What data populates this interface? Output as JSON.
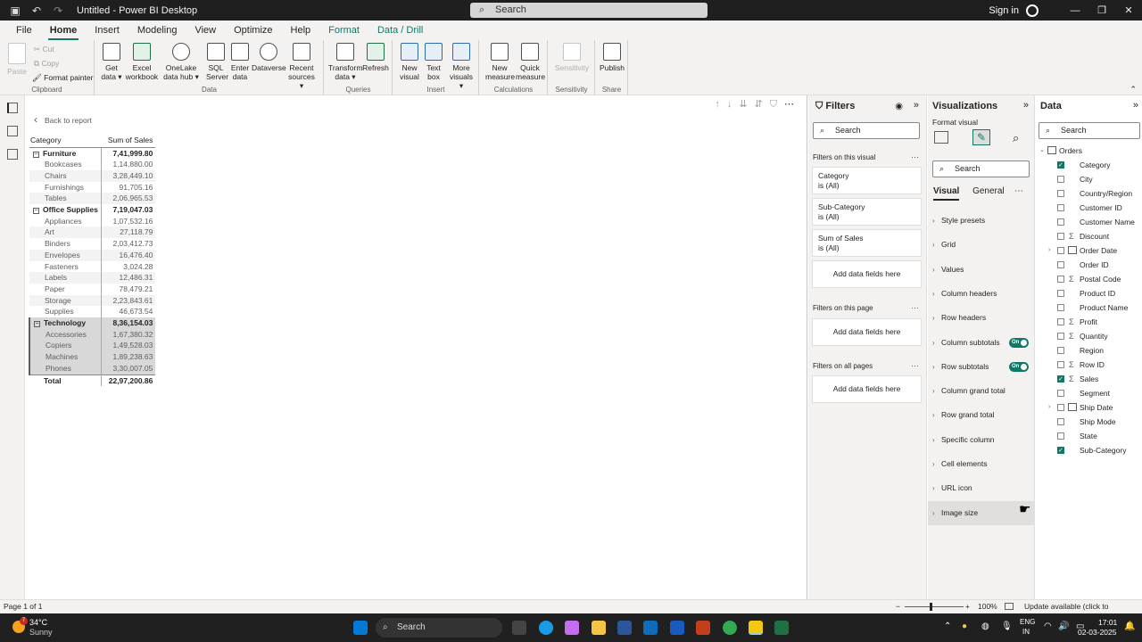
{
  "titlebar": {
    "title": "Untitled - Power BI Desktop",
    "search": "Search",
    "sign_in": "Sign in"
  },
  "menu": [
    "File",
    "Home",
    "Insert",
    "Modeling",
    "View",
    "Optimize",
    "Help",
    "Format",
    "Data / Drill"
  ],
  "ribbon": {
    "clipboard": {
      "paste": "Paste",
      "cut": "Cut",
      "copy": "Copy",
      "format_painter": "Format painter",
      "label": "Clipboard"
    },
    "data": {
      "get_data": "Get data ▾",
      "excel": "Excel workbook",
      "onelake": "OneLake data hub ▾",
      "sql": "SQL Server",
      "enter": "Enter data",
      "dataverse": "Dataverse",
      "recent": "Recent sources ▾",
      "label": "Data"
    },
    "queries": {
      "transform": "Transform data ▾",
      "refresh": "Refresh",
      "label": "Queries"
    },
    "insert": {
      "new_visual": "New visual",
      "text_box": "Text box",
      "more": "More visuals ▾",
      "label": "Insert"
    },
    "calculations": {
      "new_measure": "New measure",
      "quick_measure": "Quick measure",
      "label": "Calculations"
    },
    "sensitivity": {
      "btn": "Sensitivity",
      "label": "Sensitivity"
    },
    "share": {
      "publish": "Publish",
      "label": "Share"
    }
  },
  "canvas": {
    "back": "Back to report",
    "headers": [
      "Category",
      "Sum of Sales"
    ],
    "rows": [
      {
        "type": "cat",
        "label": "Furniture",
        "value": "7,41,999.80"
      },
      {
        "type": "sub",
        "label": "Bookcases",
        "value": "1,14,880.00"
      },
      {
        "type": "sub",
        "label": "Chairs",
        "value": "3,28,449.10"
      },
      {
        "type": "sub",
        "label": "Furnishings",
        "value": "91,705.16"
      },
      {
        "type": "sub",
        "label": "Tables",
        "value": "2,06,965.53"
      },
      {
        "type": "cat",
        "label": "Office Supplies",
        "value": "7,19,047.03"
      },
      {
        "type": "sub",
        "label": "Appliances",
        "value": "1,07,532.16"
      },
      {
        "type": "sub",
        "label": "Art",
        "value": "27,118.79"
      },
      {
        "type": "sub",
        "label": "Binders",
        "value": "2,03,412.73"
      },
      {
        "type": "sub",
        "label": "Envelopes",
        "value": "16,476.40"
      },
      {
        "type": "sub",
        "label": "Fasteners",
        "value": "3,024.28"
      },
      {
        "type": "sub",
        "label": "Labels",
        "value": "12,486.31"
      },
      {
        "type": "sub",
        "label": "Paper",
        "value": "78,479.21"
      },
      {
        "type": "sub",
        "label": "Storage",
        "value": "2,23,843.61"
      },
      {
        "type": "sub",
        "label": "Supplies",
        "value": "46,673.54"
      },
      {
        "type": "cat",
        "label": "Technology",
        "value": "8,36,154.03"
      },
      {
        "type": "sub",
        "label": "Accessories",
        "value": "1,67,380.32"
      },
      {
        "type": "sub",
        "label": "Copiers",
        "value": "1,49,528.03"
      },
      {
        "type": "sub",
        "label": "Machines",
        "value": "1,89,238.63"
      },
      {
        "type": "sub",
        "label": "Phones",
        "value": "3,30,007.05"
      },
      {
        "type": "total",
        "label": "Total",
        "value": "22,97,200.86"
      }
    ]
  },
  "filters": {
    "title": "Filters",
    "search": "Search",
    "on_visual": "Filters on this visual",
    "cards": [
      {
        "name": "Category",
        "state": "is (All)"
      },
      {
        "name": "Sub-Category",
        "state": "is (All)"
      },
      {
        "name": "Sum of Sales",
        "state": "is (All)"
      }
    ],
    "add": "Add data fields here",
    "on_page": "Filters on this page",
    "on_all": "Filters on all pages"
  },
  "viz": {
    "title": "Visualizations",
    "format_visual": "Format visual",
    "search": "Search",
    "tab_visual": "Visual",
    "tab_general": "General",
    "items": [
      "Style presets",
      "Grid",
      "Values",
      "Column headers",
      "Row headers",
      "Column subtotals",
      "Row subtotals",
      "Column grand total",
      "Row grand total",
      "Specific column",
      "Cell elements",
      "URL icon",
      "Image size"
    ],
    "toggle_on": "On"
  },
  "data": {
    "title": "Data",
    "search": "Search",
    "table": "Orders",
    "fields": [
      {
        "name": "Category",
        "checked": true,
        "kind": "text"
      },
      {
        "name": "City",
        "checked": false,
        "kind": "text"
      },
      {
        "name": "Country/Region",
        "checked": false,
        "kind": "text"
      },
      {
        "name": "Customer ID",
        "checked": false,
        "kind": "text"
      },
      {
        "name": "Customer Name",
        "checked": false,
        "kind": "text"
      },
      {
        "name": "Discount",
        "checked": false,
        "kind": "sum"
      },
      {
        "name": "Order Date",
        "checked": false,
        "kind": "date"
      },
      {
        "name": "Order ID",
        "checked": false,
        "kind": "text"
      },
      {
        "name": "Postal Code",
        "checked": false,
        "kind": "sum"
      },
      {
        "name": "Product ID",
        "checked": false,
        "kind": "text"
      },
      {
        "name": "Product Name",
        "checked": false,
        "kind": "text"
      },
      {
        "name": "Profit",
        "checked": false,
        "kind": "sum"
      },
      {
        "name": "Quantity",
        "checked": false,
        "kind": "sum"
      },
      {
        "name": "Region",
        "checked": false,
        "kind": "text"
      },
      {
        "name": "Row ID",
        "checked": false,
        "kind": "sum"
      },
      {
        "name": "Sales",
        "checked": true,
        "kind": "sum"
      },
      {
        "name": "Segment",
        "checked": false,
        "kind": "text"
      },
      {
        "name": "Ship Date",
        "checked": false,
        "kind": "date"
      },
      {
        "name": "Ship Mode",
        "checked": false,
        "kind": "text"
      },
      {
        "name": "State",
        "checked": false,
        "kind": "text"
      },
      {
        "name": "Sub-Category",
        "checked": true,
        "kind": "text"
      }
    ]
  },
  "status": {
    "page": "Page 1 of 1",
    "zoom": "100%",
    "update": "Update available (click to download)"
  },
  "taskbar": {
    "weather_temp": "34°C",
    "weather_desc": "Sunny",
    "search": "Search",
    "lang1": "ENG",
    "lang2": "IN",
    "time": "17:01",
    "date": "02-03-2025",
    "badge": "7"
  },
  "colors": {
    "accent": "#117865",
    "titlebar": "#1f1f1f",
    "pane": "#f3f2f1"
  }
}
